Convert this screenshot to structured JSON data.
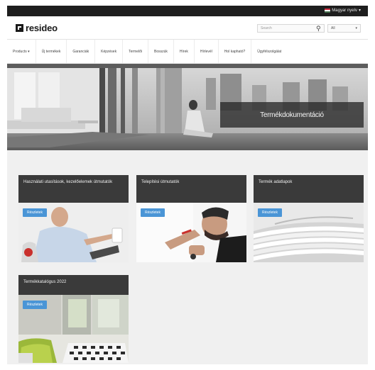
{
  "topbar": {
    "language": "Magyar nyelv"
  },
  "header": {
    "logo_text": "resideo",
    "search_placeholder": "Search",
    "scope_value": "All"
  },
  "nav": {
    "items": [
      "Products",
      "Új termékek",
      "Garanciák",
      "Képzések",
      "Termelői",
      "Bosszúk",
      "Hírek",
      "Hírlevél",
      "Hol kapható?",
      "Ügyfélszolgálat"
    ]
  },
  "hero": {
    "title": "Termékdokumentáció"
  },
  "cards": [
    {
      "title": "Használati utasítások, kezelőelemek útmutatók",
      "button": "Részletek"
    },
    {
      "title": "Telepítési útmutatók",
      "button": "Részletek"
    },
    {
      "title": "Termék adatlapok",
      "button": "Részletek"
    },
    {
      "title": "Termékkatalógus 2022",
      "button": "Részletek"
    }
  ],
  "colors": {
    "accent": "#4a95d6",
    "header_dark": "#1e1e1e",
    "card_head": "#3a3a3a"
  }
}
